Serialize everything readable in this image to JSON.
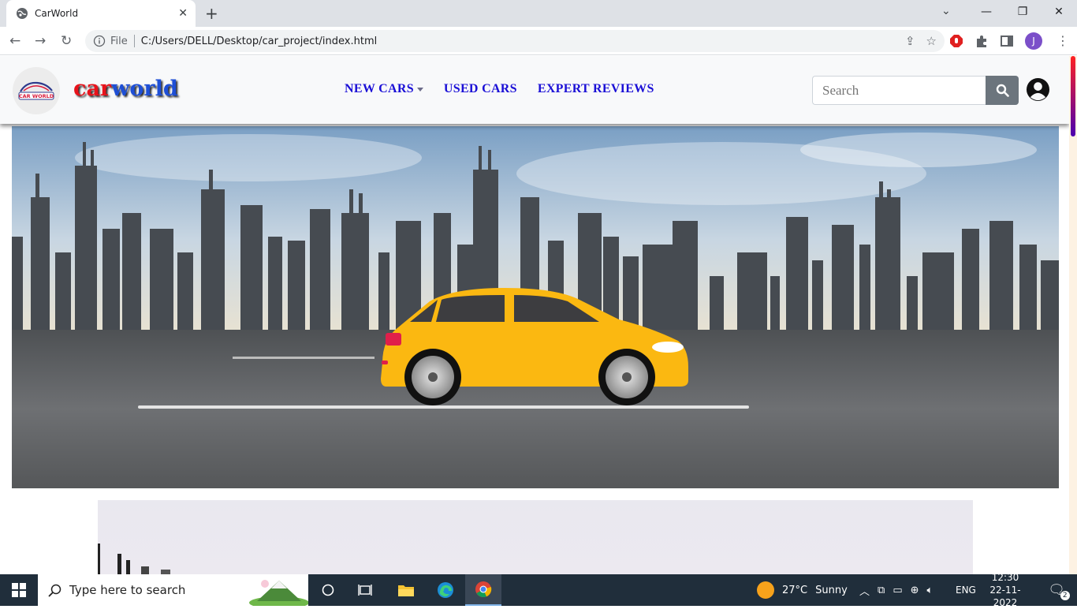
{
  "browser": {
    "tab_title": "CarWorld",
    "new_tab_symbol": "+",
    "close_tab_symbol": "✕",
    "address_label": "File",
    "url": "C:/Users/DELL/Desktop/car_project/index.html",
    "profile_initial": "J",
    "window_controls": [
      "—",
      "❐",
      "✕"
    ]
  },
  "site": {
    "logo_text": "CAR WORLD",
    "brand_part1": "car",
    "brand_part2": "world",
    "nav": {
      "new_cars": "NEW CARS",
      "used_cars": "USED CARS",
      "expert_reviews": "EXPERT REVIEWS"
    },
    "search_placeholder": "Search",
    "colors": {
      "brand_red": "#e8131b",
      "brand_blue": "#1e4fd6",
      "nav_link": "#1a0fd6",
      "search_button": "#6c757d"
    }
  },
  "taskbar": {
    "search_placeholder": "Type here to search",
    "weather_temp": "27°C",
    "weather_text": "Sunny",
    "language": "ENG",
    "time": "12:30",
    "date": "22-11-2022",
    "notification_count": "2"
  }
}
